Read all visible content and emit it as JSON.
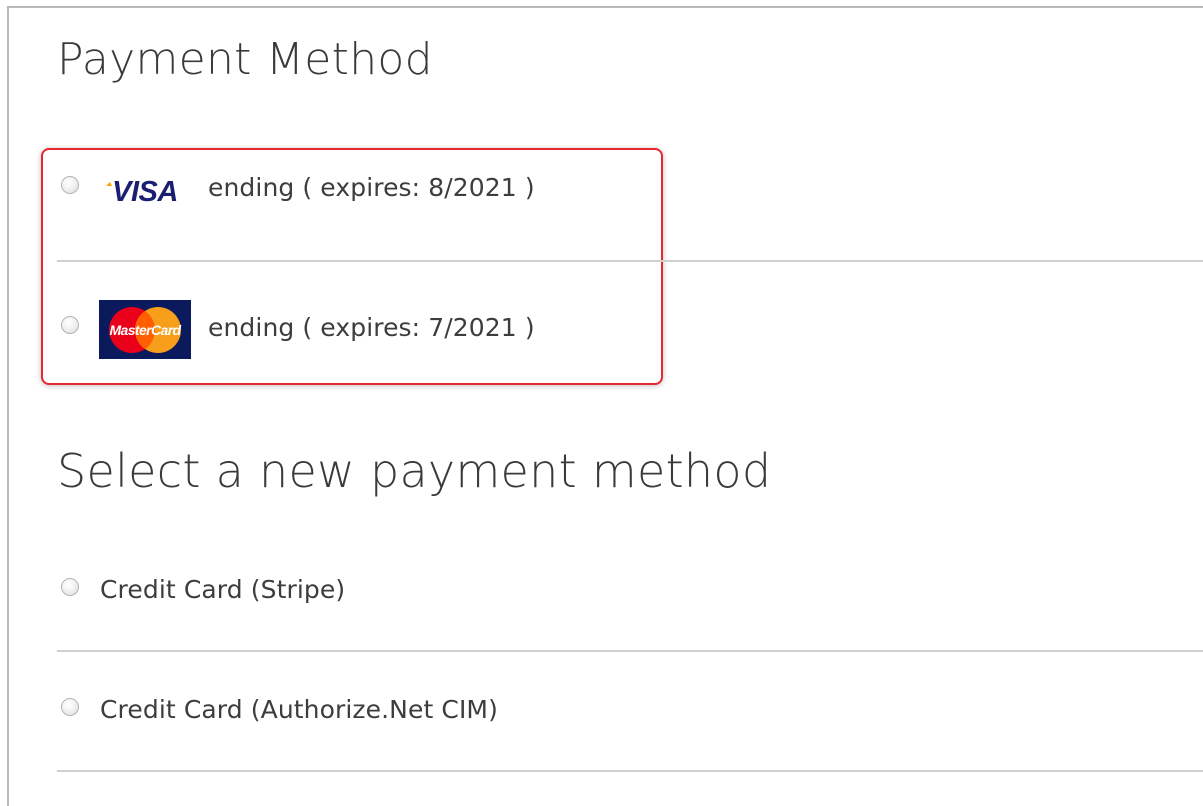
{
  "saved_methods": {
    "heading": "Payment Method",
    "cards": [
      {
        "brand": "VISA",
        "brand_icon": "visa-logo-icon",
        "label": "ending ( expires: 8/2021 )"
      },
      {
        "brand": "MasterCard",
        "brand_icon": "mastercard-logo-icon",
        "label": "ending ( expires: 7/2021 )"
      }
    ]
  },
  "new_methods": {
    "heading": "Select a new payment method",
    "options": [
      {
        "label": "Credit Card (Stripe)"
      },
      {
        "label": "Credit Card (Authorize.Net CIM)"
      }
    ]
  },
  "colors": {
    "highlight_border": "#e8262f",
    "visa_blue": "#1a1f71",
    "visa_gold": "#f7a600",
    "mastercard_red": "#eb001b",
    "mastercard_orange": "#f79e1b",
    "mastercard_bg": "#0a1a5c"
  }
}
